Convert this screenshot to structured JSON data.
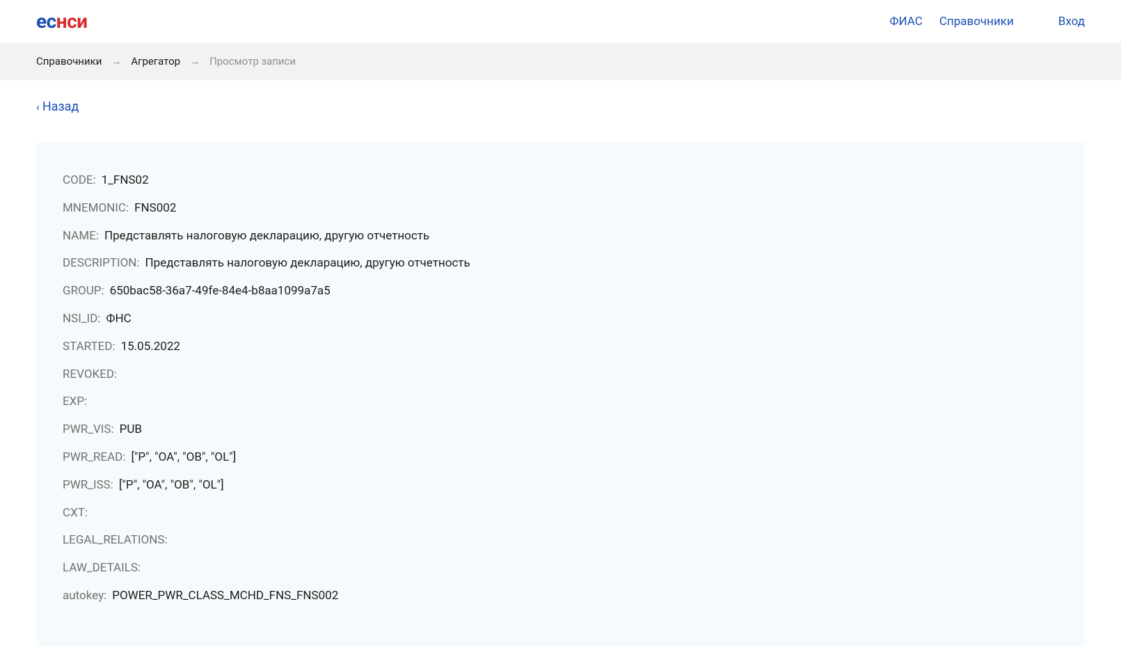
{
  "header": {
    "logo_part1": "ес",
    "logo_part2": "нси",
    "nav": {
      "fias": "ФИАС",
      "directories": "Справочники",
      "login": "Вход"
    }
  },
  "breadcrumb": {
    "item1": "Справочники",
    "item2": "Агрегатор",
    "current": "Просмотр записи"
  },
  "back": {
    "label": "Назад"
  },
  "record": {
    "fields": [
      {
        "label": "CODE:",
        "value": "1_FNS02"
      },
      {
        "label": "MNEMONIC:",
        "value": "FNS002"
      },
      {
        "label": "NAME:",
        "value": "Представлять налоговую декларацию, другую отчетность"
      },
      {
        "label": "DESCRIPTION:",
        "value": "Представлять налоговую декларацию, другую отчетность"
      },
      {
        "label": "GROUP:",
        "value": "650bac58-36a7-49fe-84e4-b8aa1099a7a5"
      },
      {
        "label": "NSI_ID:",
        "value": "ФНС"
      },
      {
        "label": "STARTED:",
        "value": "15.05.2022"
      },
      {
        "label": "REVOKED:",
        "value": ""
      },
      {
        "label": "EXP:",
        "value": ""
      },
      {
        "label": "PWR_VIS:",
        "value": "PUB"
      },
      {
        "label": "PWR_READ:",
        "value": "[\"P\", \"OA\", \"OB\", \"OL\"]"
      },
      {
        "label": "PWR_ISS:",
        "value": "[\"P\", \"OA\", \"OB\", \"OL\"]"
      },
      {
        "label": "CXT:",
        "value": ""
      },
      {
        "label": "LEGAL_RELATIONS:",
        "value": ""
      },
      {
        "label": "LAW_DETAILS:",
        "value": ""
      },
      {
        "label": "autokey:",
        "value": "POWER_PWR_CLASS_MCHD_FNS_FNS002"
      }
    ]
  }
}
